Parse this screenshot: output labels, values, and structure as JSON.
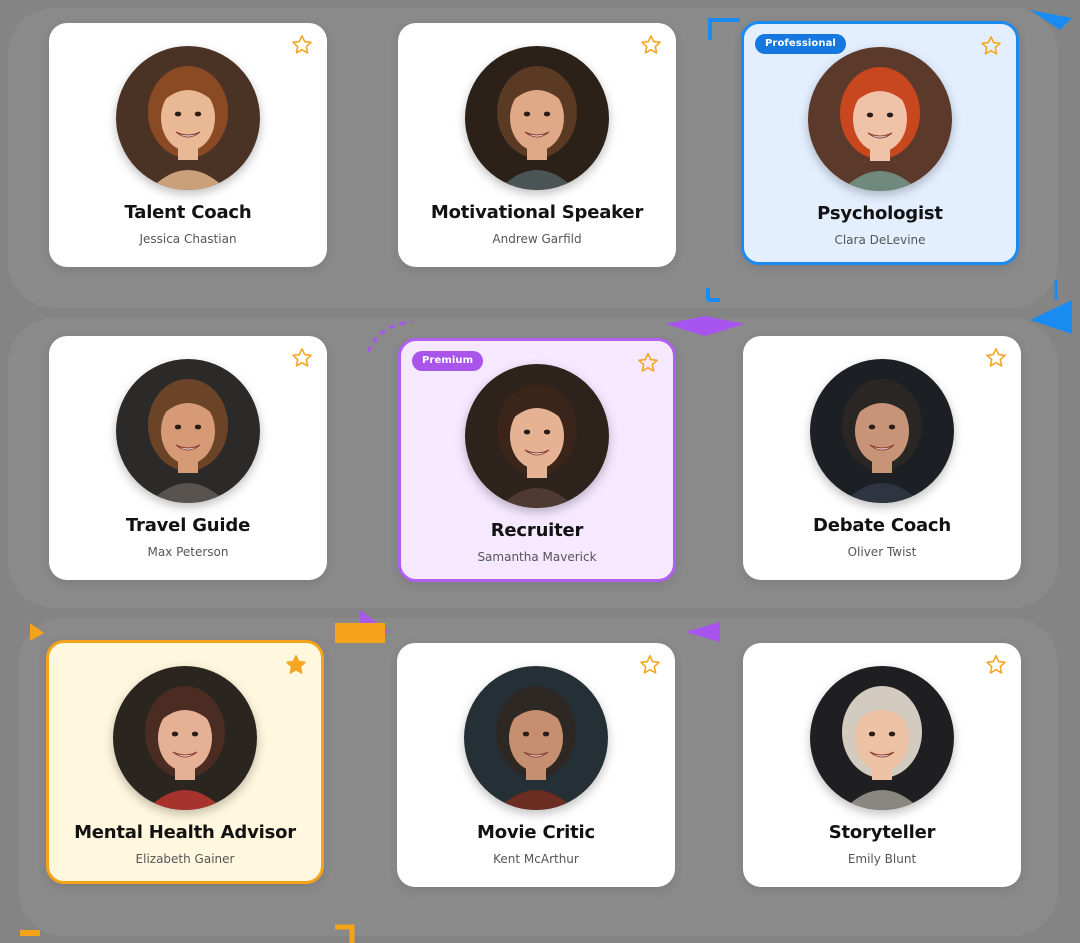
{
  "colors": {
    "professional": "#1a8bf0",
    "premium": "#b05ff0",
    "featured": "#f5a318",
    "star": "#f5a623"
  },
  "cards": [
    {
      "title": "Talent Coach",
      "name": "Jessica Chastian",
      "tier": "standard",
      "badge": "",
      "starred": false,
      "avatar": {
        "hair": "#8a4a24",
        "skin": "#e9b895",
        "bg": "#4a3324",
        "shirt": "#c9a07a"
      }
    },
    {
      "title": "Motivational Speaker",
      "name": "Andrew Garfild",
      "tier": "standard",
      "badge": "",
      "starred": false,
      "avatar": {
        "hair": "#5a3a22",
        "skin": "#dfa887",
        "bg": "#2b2119",
        "shirt": "#4a5454"
      }
    },
    {
      "title": "Psychologist",
      "name": "Clara DeLevine",
      "tier": "professional",
      "badge": "Professional",
      "starred": false,
      "avatar": {
        "hair": "#c9471f",
        "skin": "#f0c2a8",
        "bg": "#5b3a2c",
        "shirt": "#6f8a7c"
      }
    },
    {
      "title": "Travel Guide",
      "name": "Max Peterson",
      "tier": "standard",
      "badge": "",
      "starred": false,
      "avatar": {
        "hair": "#6b4428",
        "skin": "#d79a76",
        "bg": "#2c2a28",
        "shirt": "#595350"
      }
    },
    {
      "title": "Recruiter",
      "name": "Samantha Maverick",
      "tier": "premium",
      "badge": "Premium",
      "starred": false,
      "avatar": {
        "hair": "#3b241a",
        "skin": "#e5b394",
        "bg": "#2e221c",
        "shirt": "#4e3a30"
      }
    },
    {
      "title": "Debate Coach",
      "name": "Oliver Twist",
      "tier": "standard",
      "badge": "",
      "starred": false,
      "avatar": {
        "hair": "#2a2624",
        "skin": "#c79478",
        "bg": "#1c1f24",
        "shirt": "#2f3540"
      }
    },
    {
      "title": "Mental Health Advisor",
      "name": "Elizabeth Gainer",
      "tier": "featured",
      "badge": "",
      "starred": true,
      "avatar": {
        "hair": "#4a2c22",
        "skin": "#e6b094",
        "bg": "#2b2520",
        "shirt": "#a8322c"
      }
    },
    {
      "title": "Movie Critic",
      "name": "Kent McArthur",
      "tier": "standard",
      "badge": "",
      "starred": false,
      "avatar": {
        "hair": "#2e2824",
        "skin": "#c58f70",
        "bg": "#243036",
        "shirt": "#6b2c22"
      }
    },
    {
      "title": "Storyteller",
      "name": "Emily Blunt",
      "tier": "standard",
      "badge": "",
      "starred": false,
      "avatar": {
        "hair": "#d4cbc0",
        "skin": "#eec2a5",
        "bg": "#1f1f22",
        "shirt": "#8a8680"
      }
    }
  ]
}
